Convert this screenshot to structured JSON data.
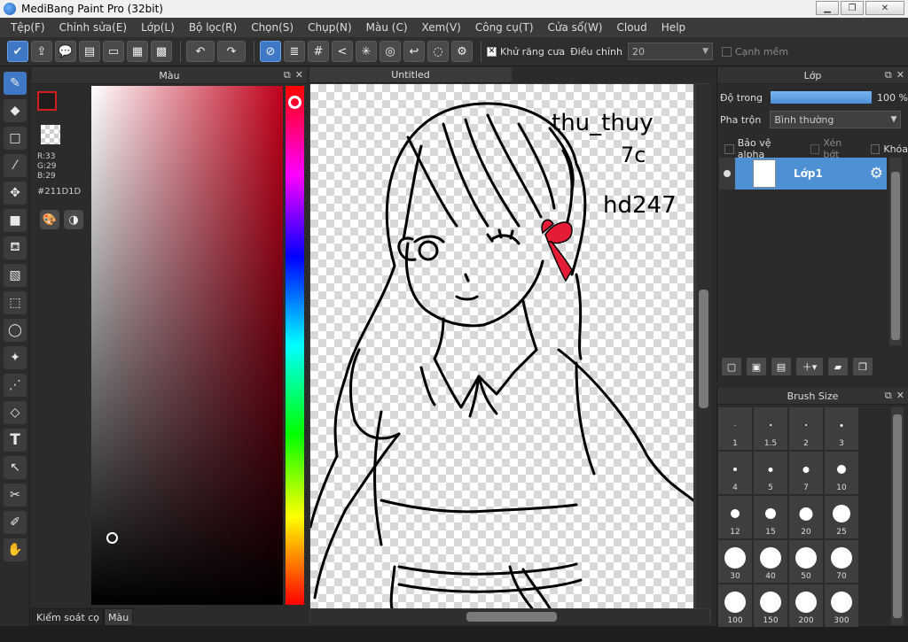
{
  "window": {
    "title": "MediBang Paint Pro (32bit)"
  },
  "menu": [
    "Tệp(F)",
    "Chỉnh sửa(E)",
    "Lớp(L)",
    "Bộ lọc(R)",
    "Chọn(S)",
    "Chụp(N)",
    "Màu (C)",
    "Xem(V)",
    "Công cụ(T)",
    "Cửa sổ(W)",
    "Cloud",
    "Help"
  ],
  "toolbar": {
    "antialias_label": "Khử răng cưa",
    "antialias_checked": true,
    "adjust_label": "Điều chỉnh",
    "adjust_value": "20",
    "soft_edge_label": "Cạnh mềm",
    "soft_edge_checked": false
  },
  "color_panel": {
    "title": "Màu",
    "rgb": "R:33\nG:29\nB:29",
    "hex": "#211D1D",
    "foreground_color": "#211D1D",
    "hue_color": "#C0001B",
    "tab_brush_control": "Kiểm soát cọ",
    "tab_color": "Màu"
  },
  "document": {
    "tab_title": "Untitled"
  },
  "canvas_text": {
    "line1": "thu_thuy",
    "line2": "7c",
    "line3": "hd247"
  },
  "layer_panel": {
    "title": "Lớp",
    "opacity_label": "Độ trong",
    "opacity_value": "100 %",
    "opacity_fraction": 1.0,
    "blend_label": "Pha trộn",
    "blend_value": "Bình thường",
    "protect_alpha_label": "Bảo vệ alpha",
    "clip_label": "Xén bớt",
    "lock_label": "Khóa",
    "layers": [
      {
        "name": "Lớp1"
      }
    ]
  },
  "brush_panel": {
    "title": "Brush Size",
    "sizes": [
      "1",
      "1.5",
      "2",
      "3",
      "4",
      "5",
      "7",
      "10",
      "12",
      "15",
      "20",
      "25",
      "30",
      "40",
      "50",
      "70",
      "100",
      "150",
      "200",
      "300"
    ]
  }
}
